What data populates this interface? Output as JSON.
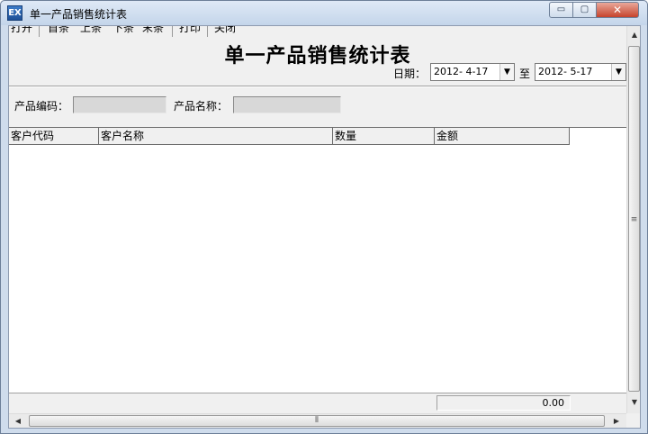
{
  "window": {
    "title": "单一产品销售统计表",
    "icon": "app-logo-icon",
    "icon_glyph": "EX",
    "controls": {
      "minimize": "▭",
      "maximize": "▢",
      "close": "✕"
    }
  },
  "menu": {
    "items": [
      "打开",
      "首条",
      "上条",
      "下条",
      "末条",
      "打印",
      "关闭"
    ]
  },
  "report": {
    "title": "单一产品销售统计表",
    "date_label": "日期：",
    "date_from": "2012- 4-17",
    "to_label": "至",
    "date_to": "2012- 5-17",
    "dropdown_arrow": "▼"
  },
  "filters": {
    "product_code_label": "产品编码：",
    "product_code_value": "",
    "product_name_label": "产品名称：",
    "product_name_value": ""
  },
  "table": {
    "columns": [
      "客户代码",
      "客户名称",
      "数量",
      "金额"
    ],
    "rows": []
  },
  "footer": {
    "total_amount": "0.00"
  },
  "scrollbars": {
    "up": "▲",
    "down": "▼",
    "left": "◀",
    "right": "▶",
    "grip_v": "≡",
    "grip_h": "⦀"
  },
  "colors": {
    "title_bar": "#c4d5ea",
    "close_button": "#c6432c",
    "input_fill": "#d8d8d8"
  }
}
